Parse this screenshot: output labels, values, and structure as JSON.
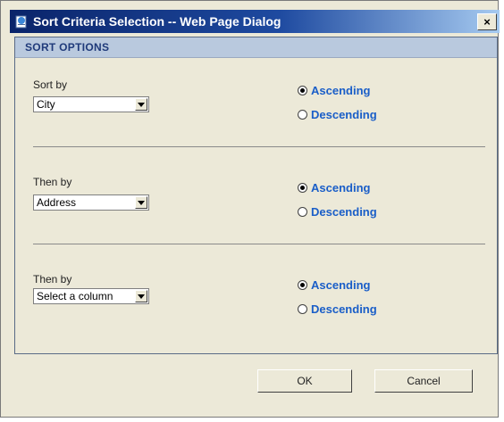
{
  "window": {
    "title": "Sort Criteria Selection -- Web Page Dialog",
    "close_glyph": "×"
  },
  "panel": {
    "header": "SORT OPTIONS"
  },
  "sort_rows": [
    {
      "label": "Sort by",
      "selected": "City",
      "order": "Ascending"
    },
    {
      "label": "Then by",
      "selected": "Address",
      "order": "Ascending"
    },
    {
      "label": "Then by",
      "selected": "Select a column",
      "order": "Ascending"
    }
  ],
  "order_options": {
    "ascending": "Ascending",
    "descending": "Descending"
  },
  "buttons": {
    "ok": "OK",
    "cancel": "Cancel"
  },
  "colors": {
    "accent_text": "#1a5ec8",
    "panel_header_bg": "#b9c9de",
    "titlebar_start": "#0a246a"
  }
}
